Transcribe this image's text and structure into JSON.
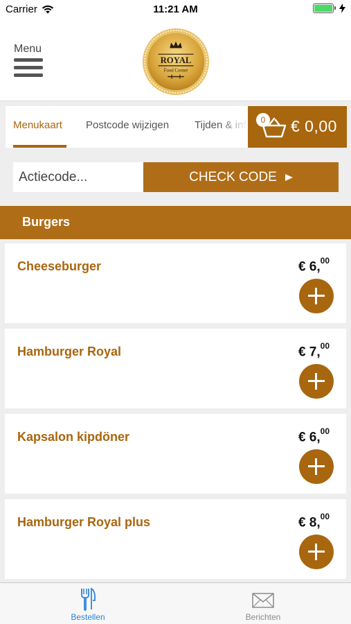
{
  "status_bar": {
    "carrier": "Carrier",
    "time": "11:21 AM",
    "wifi_icon": "wifi-icon",
    "battery_icon": "battery-icon",
    "battery_level": 1.0,
    "charging_icon": "bolt-icon"
  },
  "header": {
    "menu_label": "Menu",
    "logo_title": "ROYAL",
    "logo_subtitle": "Food Corner"
  },
  "tabs": [
    {
      "label": "Menukaart",
      "active": true
    },
    {
      "label": "Postcode wijzigen",
      "active": false
    },
    {
      "label": "Tijden & info",
      "active": false
    }
  ],
  "cart": {
    "count": "0",
    "total": "€ 0,00",
    "icon": "basket-icon"
  },
  "action_code": {
    "placeholder": "Actiecode...",
    "value": "",
    "button_label": "CHECK CODE"
  },
  "category": {
    "title": "Burgers"
  },
  "products": [
    {
      "name": "Cheeseburger",
      "price_main": "€ 6,",
      "price_cents": "00"
    },
    {
      "name": "Hamburger Royal",
      "price_main": "€ 7,",
      "price_cents": "00"
    },
    {
      "name": "Kapsalon kipdöner",
      "price_main": "€ 6,",
      "price_cents": "00"
    },
    {
      "name": "Hamburger Royal plus",
      "price_main": "€ 8,",
      "price_cents": "00"
    }
  ],
  "tab_bar": {
    "items": [
      {
        "label": "Bestellen",
        "icon": "fork-knife-icon",
        "active": true
      },
      {
        "label": "Berichten",
        "icon": "envelope-icon",
        "active": false
      }
    ]
  },
  "colors": {
    "brand": "#a8660f",
    "brand_bar": "#b06d17",
    "active_tab_blue": "#2b84d8",
    "background": "#eeeeee"
  }
}
